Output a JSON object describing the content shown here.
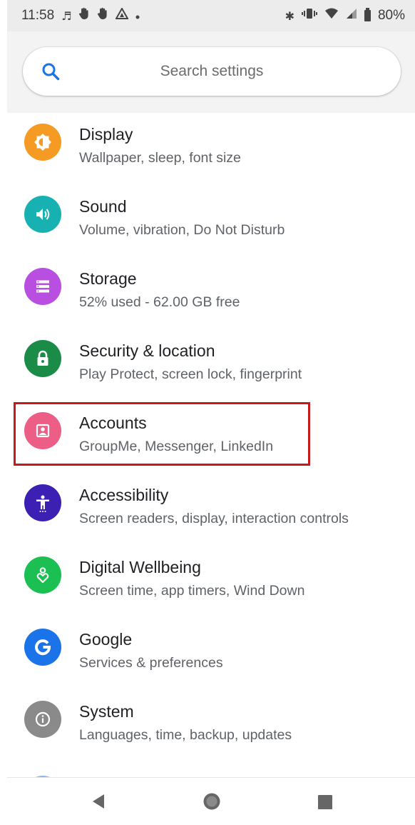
{
  "status_bar": {
    "time": "11:58",
    "left_icons": [
      "music-note-icon",
      "hand-icon",
      "hand-icon",
      "warning-icon",
      "dot-icon"
    ],
    "right_icons": [
      "bluetooth-icon",
      "vibrate-icon",
      "wifi-icon",
      "signal-icon",
      "battery-icon"
    ],
    "battery_percent": "80%"
  },
  "search": {
    "placeholder": "Search settings"
  },
  "settings": [
    {
      "title": "Display",
      "subtitle": "Wallpaper, sleep, font size",
      "icon": "brightness-icon",
      "color": "#f59a23"
    },
    {
      "title": "Sound",
      "subtitle": "Volume, vibration, Do Not Disturb",
      "icon": "volume-icon",
      "color": "#18b1b1"
    },
    {
      "title": "Storage",
      "subtitle": "52% used - 62.00 GB free",
      "icon": "storage-icon",
      "color": "#b94fe0"
    },
    {
      "title": "Security & location",
      "subtitle": "Play Protect, screen lock, fingerprint",
      "icon": "lock-icon",
      "color": "#1a8c47"
    },
    {
      "title": "Accounts",
      "subtitle": "GroupMe, Messenger, LinkedIn",
      "icon": "account-icon",
      "color": "#ec5e86"
    },
    {
      "title": "Accessibility",
      "subtitle": "Screen readers, display, interaction controls",
      "icon": "accessibility-icon",
      "color": "#3c1fb3"
    },
    {
      "title": "Digital Wellbeing",
      "subtitle": "Screen time, app timers, Wind Down",
      "icon": "wellbeing-icon",
      "color": "#1bbf52"
    },
    {
      "title": "Google",
      "subtitle": "Services & preferences",
      "icon": "google-icon",
      "color": "#1a73e8"
    },
    {
      "title": "System",
      "subtitle": "Languages, time, backup, updates",
      "icon": "info-icon",
      "color": "#8a8a8a"
    }
  ],
  "partial_item": {
    "icon": "about-phone-icon",
    "color": "#8ab4f8"
  },
  "highlight": {
    "target": "Accounts",
    "color": "#c41a1a"
  },
  "nav_bar": {
    "buttons": [
      "back-icon",
      "home-icon",
      "recents-icon"
    ]
  }
}
